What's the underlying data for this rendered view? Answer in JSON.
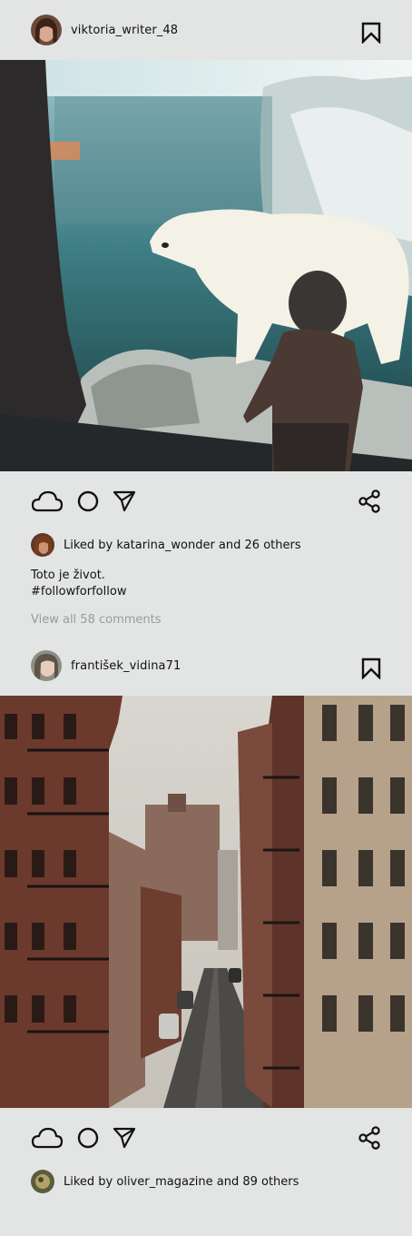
{
  "posts": [
    {
      "username": "viktoria_writer_48",
      "liked_by_text": "Liked by katarina_wonder and 26 others",
      "caption_line1": "Toto je život.",
      "caption_line2": "#followforfollow",
      "comments_link": "View all 58 comments"
    },
    {
      "username": "františek_vidina71",
      "liked_by_text": "Liked by oliver_magazine and 89 others"
    }
  ],
  "icons": {
    "like": "cloud-icon",
    "comment": "circle-icon",
    "send": "send-arrow-icon",
    "share": "share-nodes-icon",
    "bookmark": "bookmark-icon"
  },
  "colors": {
    "background": "#e3e5e4",
    "muted_text": "#9a9c9c"
  }
}
